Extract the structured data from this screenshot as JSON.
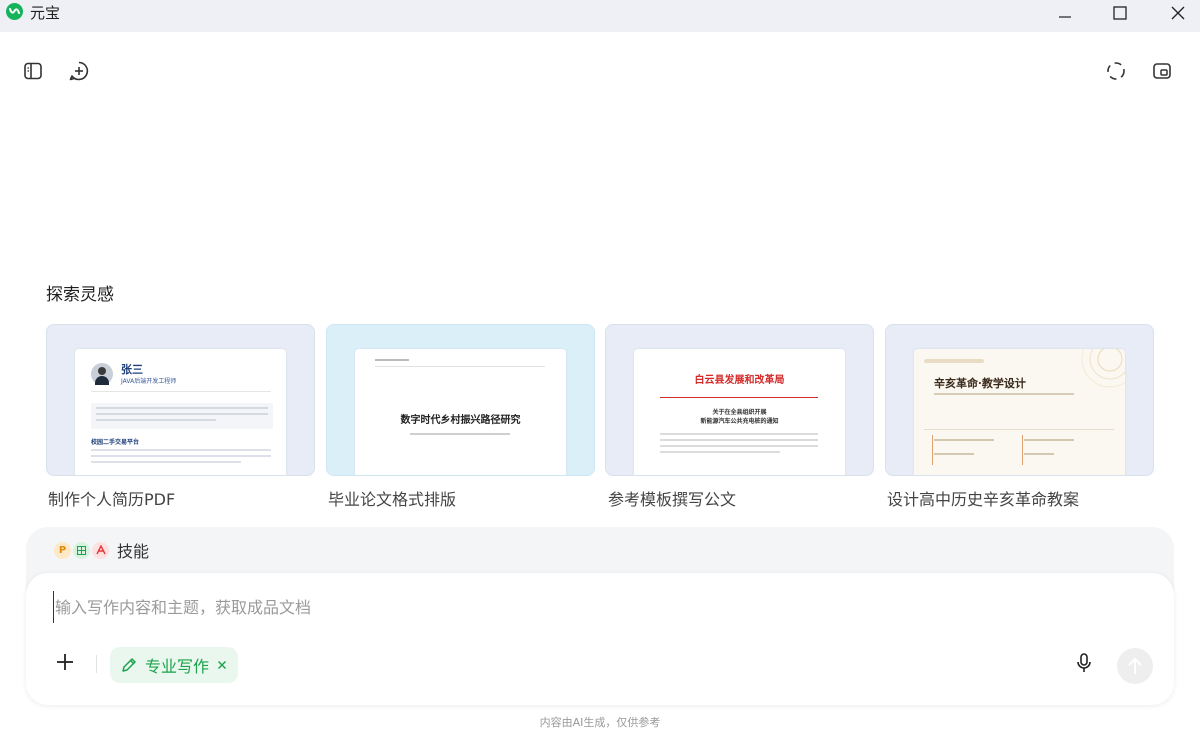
{
  "app": {
    "title": "元宝",
    "logo_color": "#16b35a"
  },
  "window_controls": {
    "minimize": "minimize-icon",
    "maximize": "maximize-icon",
    "close": "close-icon"
  },
  "toolbar": {
    "left": [
      "sidebar-toggle-icon",
      "new-chat-icon"
    ],
    "right": [
      "screenshot-icon",
      "picture-in-picture-icon"
    ]
  },
  "inspiration": {
    "title": "探索灵感",
    "cards": [
      {
        "label": "制作个人简历PDF",
        "preview": {
          "name": "张三",
          "role": "JAVA后端开发工程师",
          "section": "校园二手交易平台"
        }
      },
      {
        "label": "毕业论文格式排版",
        "preview": {
          "title": "数字时代乡村振兴路径研究"
        }
      },
      {
        "label": "参考模板撰写公文",
        "preview": {
          "header": "白云县发展和改革局",
          "subject_line1": "关于在全县组织开展",
          "subject_line2": "新能源汽车公共充电桩的通知"
        }
      },
      {
        "label": "设计高中历史辛亥革命教案",
        "preview": {
          "title": "辛亥革命·教学设计"
        }
      }
    ]
  },
  "skills": {
    "label": "技能",
    "icons": [
      "P",
      "表",
      "A"
    ]
  },
  "composer": {
    "placeholder": "输入写作内容和主题，获取成品文档",
    "mode_chip": "专业写作",
    "accent": "#1aa34a"
  },
  "footer": {
    "note": "内容由AI生成，仅供参考"
  }
}
